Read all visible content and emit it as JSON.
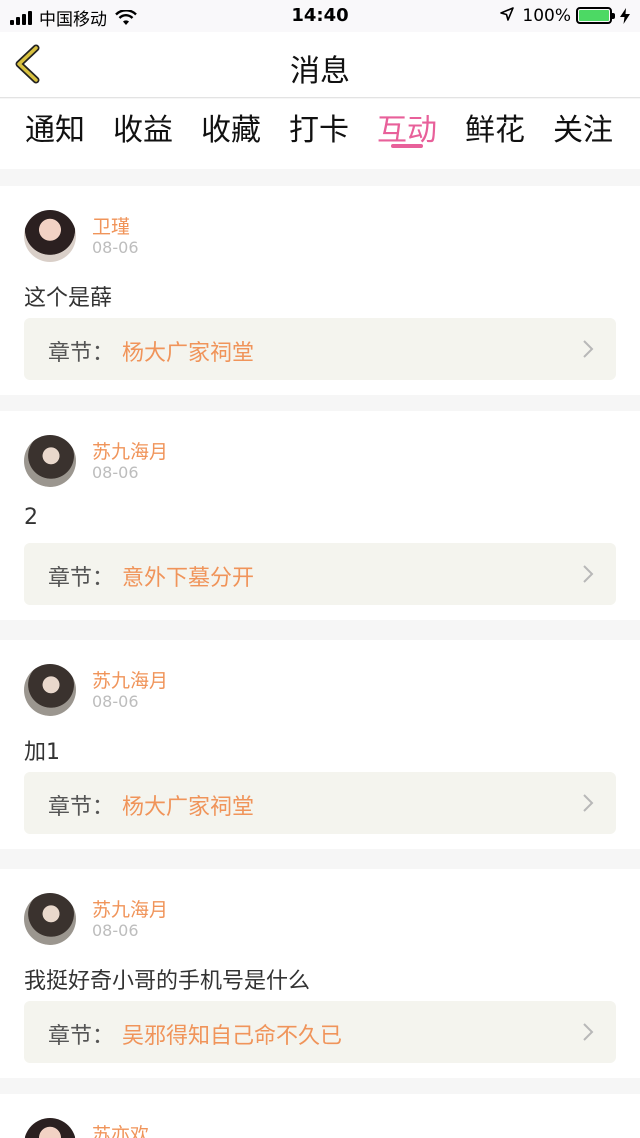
{
  "status_bar": {
    "carrier": "中国移动",
    "time": "14:40",
    "battery": "100%"
  },
  "nav": {
    "title": "消息"
  },
  "tabs": [
    {
      "label": "通知"
    },
    {
      "label": "收益"
    },
    {
      "label": "收藏"
    },
    {
      "label": "打卡"
    },
    {
      "label": "互动",
      "active": true
    },
    {
      "label": "鲜花"
    },
    {
      "label": "关注"
    }
  ],
  "messages": [
    {
      "user": "卫瑾",
      "time": "08-06",
      "content": "这个是薛",
      "chapter_label": "章节：",
      "chapter": "杨大广家祠堂"
    },
    {
      "user": "苏九海月",
      "time": "08-06",
      "content": "2",
      "chapter_label": "章节：",
      "chapter": "意外下墓分开"
    },
    {
      "user": "苏九海月",
      "time": "08-06",
      "content": "加1",
      "chapter_label": "章节：",
      "chapter": "杨大广家祠堂"
    },
    {
      "user": "苏九海月",
      "time": "08-06",
      "content": "我挺好奇小哥的手机号是什么",
      "chapter_label": "章节：",
      "chapter": "吴邪得知自己命不久已"
    },
    {
      "user": "苏亦欢"
    }
  ],
  "colors": {
    "accent": "#e8609a",
    "username": "#f0945a",
    "battery": "#4cd964",
    "back_arrow": "#c8b030"
  }
}
